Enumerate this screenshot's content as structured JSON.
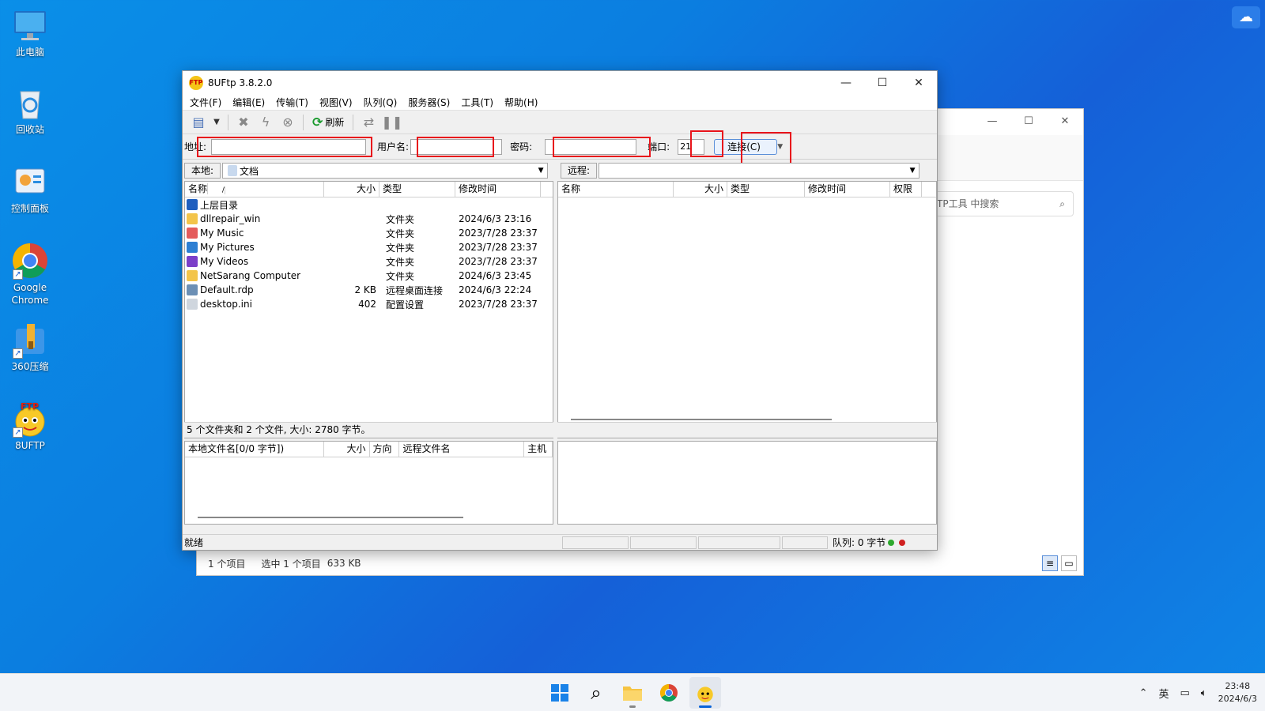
{
  "desktop": {
    "icons": [
      {
        "label": "此电脑",
        "icon": "computer-icon"
      },
      {
        "label": "回收站",
        "icon": "recycle-bin-icon"
      },
      {
        "label": "控制面板",
        "icon": "control-panel-icon"
      },
      {
        "label": "Google\nChrome",
        "icon": "chrome-icon"
      },
      {
        "label": "360压缩",
        "icon": "zip-icon"
      },
      {
        "label": "8UFTP",
        "icon": "ftp-icon"
      }
    ]
  },
  "explorer": {
    "search_placeholder": "TP工具 中搜索",
    "status_items": "1 个项目",
    "status_selected": "选中 1 个项目",
    "status_size": "633 KB"
  },
  "ftp": {
    "title": "8UFtp 3.8.2.0",
    "icon_text": "FTP",
    "menu": [
      "文件(F)",
      "编辑(E)",
      "传输(T)",
      "视图(V)",
      "队列(Q)",
      "服务器(S)",
      "工具(T)",
      "帮助(H)"
    ],
    "toolbar": {
      "refresh_label": "刷新"
    },
    "connection": {
      "address_label": "地址:",
      "address_value": "",
      "username_label": "用户名:",
      "username_value": "",
      "password_label": "密码:",
      "password_value": "",
      "port_label": "端口:",
      "port_value": "21",
      "connect_label": "连接(C)"
    },
    "local": {
      "path_label": "本地:",
      "path_value": "文档",
      "columns": [
        "名称",
        "大小",
        "类型",
        "修改时间"
      ],
      "sort_indicator": "/",
      "files": [
        {
          "name": "上层目录",
          "size": "",
          "type": "",
          "modified": "",
          "icon": "up-folder-icon",
          "color": "#1f5fbf"
        },
        {
          "name": "dllrepair_win",
          "size": "",
          "type": "文件夹",
          "modified": "2024/6/3 23:16",
          "icon": "folder-icon",
          "color": "#f3c44a"
        },
        {
          "name": "My Music",
          "size": "",
          "type": "文件夹",
          "modified": "2023/7/28 23:37",
          "icon": "music-icon",
          "color": "#e45b5b"
        },
        {
          "name": "My Pictures",
          "size": "",
          "type": "文件夹",
          "modified": "2023/7/28 23:37",
          "icon": "pictures-icon",
          "color": "#2d7fd3"
        },
        {
          "name": "My Videos",
          "size": "",
          "type": "文件夹",
          "modified": "2023/7/28 23:37",
          "icon": "videos-icon",
          "color": "#7b3fc9"
        },
        {
          "name": "NetSarang Computer",
          "size": "",
          "type": "文件夹",
          "modified": "2024/6/3 23:45",
          "icon": "folder-icon",
          "color": "#f3c44a"
        },
        {
          "name": "Default.rdp",
          "size": "2 KB",
          "type": "远程桌面连接",
          "modified": "2024/6/3 22:24",
          "icon": "rdp-icon",
          "color": "#6b8fb5"
        },
        {
          "name": "desktop.ini",
          "size": "402",
          "type": "配置设置",
          "modified": "2023/7/28 23:37",
          "icon": "ini-file-icon",
          "color": "#cfd6de"
        }
      ],
      "status": "5 个文件夹和 2 个文件, 大小: 2780 字节。"
    },
    "remote": {
      "path_label": "远程:",
      "path_value": "",
      "columns": [
        "名称",
        "大小",
        "类型",
        "修改时间",
        "权限"
      ]
    },
    "queue": {
      "columns": [
        "本地文件名[0/0 字节])",
        "大小",
        "方向",
        "远程文件名",
        "主机"
      ]
    },
    "statusbar": {
      "ready": "就绪",
      "queue": "队列: 0 字节"
    }
  },
  "taskbar": {
    "tray_lang": "英",
    "time": "23:48",
    "date": "2024/6/3"
  },
  "colors": {
    "highlight_box": "#e8141b",
    "desktop_blue": "#0b7ee0"
  }
}
